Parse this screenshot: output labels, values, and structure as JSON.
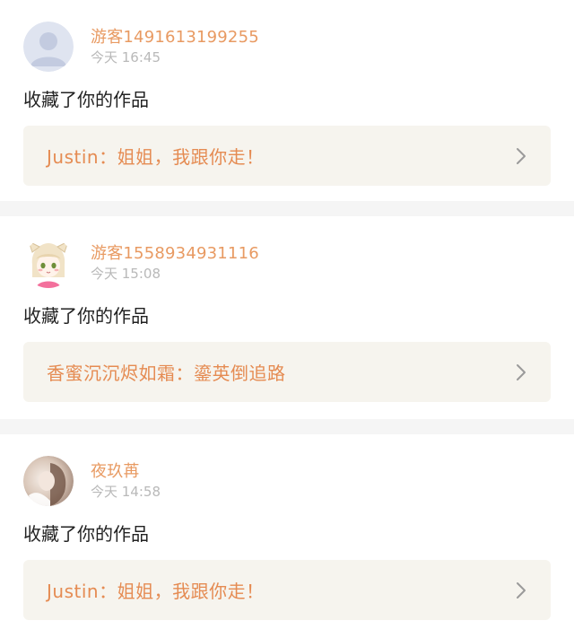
{
  "colors": {
    "username": "#e89a62",
    "work_title": "#e58b52",
    "timestamp": "#b9b9b9",
    "action_text": "#222222",
    "work_bg": "#f6f4ee",
    "separator": "#f5f5f5"
  },
  "notifications": [
    {
      "avatar_icon": "default-user-avatar-icon",
      "username": "游客1491613199255",
      "time": "今天 16:45",
      "action": "收藏了你的作品",
      "work_title": "Justin：姐姐，我跟你走！",
      "chevron_icon": "chevron-right-icon"
    },
    {
      "avatar_icon": "anime-girl-avatar-icon",
      "username": "游客1558934931116",
      "time": "今天 15:08",
      "action": "收藏了你的作品",
      "work_title": "香蜜沉沉烬如霜：鎏英倒追路",
      "chevron_icon": "chevron-right-icon"
    },
    {
      "avatar_icon": "photo-avatar-icon",
      "username": "夜玖苒",
      "time": "今天 14:58",
      "action": "收藏了你的作品",
      "work_title": "Justin：姐姐，我跟你走！",
      "chevron_icon": "chevron-right-icon"
    }
  ]
}
